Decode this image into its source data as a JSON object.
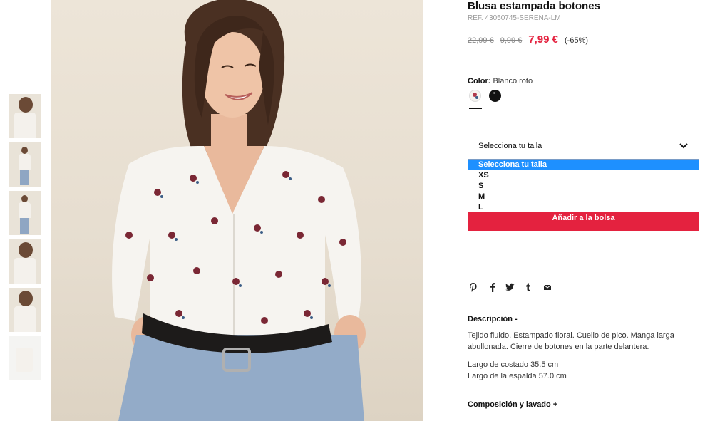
{
  "product": {
    "title": "Blusa estampada botones",
    "ref": "REF. 43050745-SERENA-LM",
    "prices": {
      "original": "22,99 €",
      "previous": "9,99 €",
      "sale": "7,99 €",
      "discount": "(-65%)"
    },
    "color": {
      "label": "Color:",
      "value": "Blanco roto",
      "swatches": [
        "white-floral-swatch",
        "black-swatch"
      ]
    },
    "size": {
      "selected": "Selecciona tu talla",
      "options": [
        "Selecciona tu talla",
        "XS",
        "S",
        "M",
        "L"
      ]
    },
    "add_to_bag": "Añadir a la bolsa"
  },
  "share_icons": [
    "pinterest-icon",
    "facebook-icon",
    "twitter-icon",
    "tumblr-icon",
    "email-icon"
  ],
  "description": {
    "heading": "Descripción -",
    "text": "Tejido fluido. Estampado floral. Cuello de pico. Manga larga abullonada. Cierre de botones en la parte delantera.",
    "measure_1": "Largo de costado 35.5 cm",
    "measure_2": "Largo de la espalda 57.0 cm"
  },
  "composition": {
    "heading": "Composición y lavado +"
  },
  "colors": {
    "accent": "#e4223f",
    "selected_option": "#1e90ff"
  }
}
